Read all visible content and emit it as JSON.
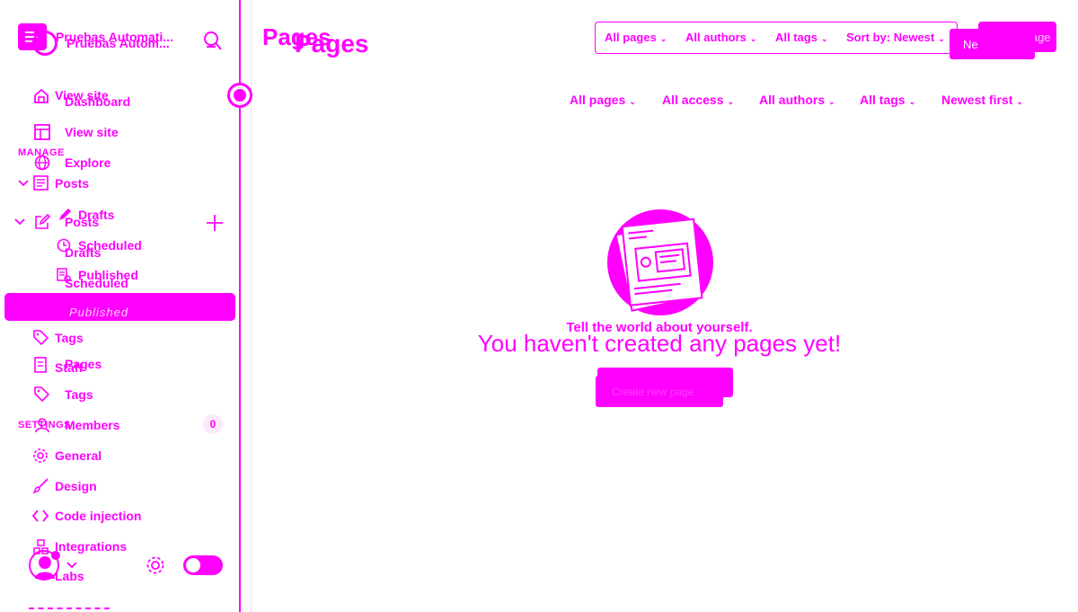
{
  "app": {
    "site_name_a": "Pruebas Automati...",
    "site_name_b": "Pruebas Autom...",
    "site_initial": "P"
  },
  "sidebar_back": {
    "items": [
      {
        "label": "Dashboard"
      },
      {
        "label": "View site"
      },
      {
        "label": "Explore"
      },
      {
        "label": "Posts"
      },
      {
        "label": "Drafts"
      },
      {
        "label": "Scheduled"
      },
      {
        "label": "Published"
      },
      {
        "label": "Pages"
      },
      {
        "label": "Tags"
      },
      {
        "label": "Members"
      },
      {
        "label": "Labs"
      }
    ],
    "members_count": "0"
  },
  "sidebar_front": {
    "items": [
      {
        "label": "View site"
      },
      {
        "label": "Posts"
      },
      {
        "label": "Drafts"
      },
      {
        "label": "Scheduled"
      },
      {
        "label": "Published"
      },
      {
        "label": "Tags"
      },
      {
        "label": "Staff"
      },
      {
        "label": "General"
      },
      {
        "label": "Design"
      },
      {
        "label": "Code injection"
      },
      {
        "label": "Integrations"
      }
    ],
    "section_manage": "MANAGE",
    "section_settings": "SETTINGS"
  },
  "header": {
    "title_a": "Pages",
    "title_b": "Pages",
    "new_page_a": "New page",
    "new_page_b": "Ne"
  },
  "filters_top": [
    {
      "label": "All pages"
    },
    {
      "label": "All authors"
    },
    {
      "label": "All tags"
    },
    {
      "label": "Sort by: Newest"
    }
  ],
  "filters_bottom": [
    {
      "label": "All pages"
    },
    {
      "label": "All access"
    },
    {
      "label": "All authors"
    },
    {
      "label": "All tags"
    },
    {
      "label": "Newest first"
    }
  ],
  "empty": {
    "tagline": "Tell the world about yourself.",
    "heading": "You haven't created any pages yet!",
    "cta": "Create new page"
  },
  "colors": {
    "accent": "#ff00ff",
    "background": "#ffffff"
  }
}
